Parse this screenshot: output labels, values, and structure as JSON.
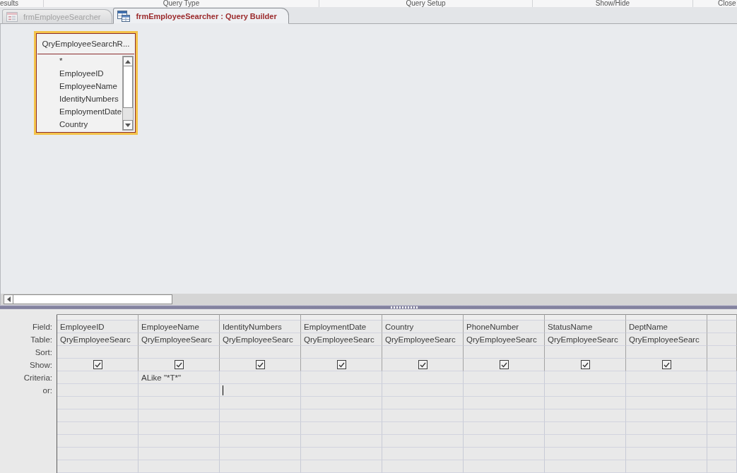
{
  "ribbon_groups": [
    {
      "label": "esults"
    },
    {
      "label": "Query Type"
    },
    {
      "label": "Query Setup"
    },
    {
      "label": "Show/Hide"
    },
    {
      "label": "Close"
    }
  ],
  "document_tabs": [
    {
      "label": "frmEmployeeSearcher",
      "kind": "form",
      "selected": false
    },
    {
      "label": "frmEmployeeSearcher : Query Builder",
      "kind": "query",
      "selected": true
    }
  ],
  "field_list": {
    "title": "QryEmployeeSearchR...",
    "fields": [
      "*",
      "EmployeeID",
      "EmployeeName",
      "IdentityNumbers",
      "EmploymentDate",
      "Country"
    ]
  },
  "design_grid": {
    "rows": [
      {
        "label": "Field:",
        "kind": "field"
      },
      {
        "label": "Table:",
        "kind": "table"
      },
      {
        "label": "Sort:",
        "kind": "sort"
      },
      {
        "label": "Show:",
        "kind": "show"
      },
      {
        "label": "Criteria:",
        "kind": "criteria"
      },
      {
        "label": "or:",
        "kind": "or"
      }
    ],
    "columns": [
      {
        "field": "EmployeeID",
        "table": "QryEmployeeSearc",
        "show": true,
        "editing": false
      },
      {
        "field": "EmployeeName",
        "table": "QryEmployeeSearc",
        "show": true,
        "criteria": "ALike \"*T*\"",
        "editing": false
      },
      {
        "field": "IdentityNumbers",
        "table": "QryEmployeeSearc",
        "show": true,
        "editing": true
      },
      {
        "field": "EmploymentDate",
        "table": "QryEmployeeSearc",
        "show": true,
        "editing": false
      },
      {
        "field": "Country",
        "table": "QryEmployeeSearc",
        "show": true,
        "editing": false
      },
      {
        "field": "PhoneNumber",
        "table": "QryEmployeeSearc",
        "show": true,
        "editing": false
      },
      {
        "field": "StatusName",
        "table": "QryEmployeeSearc",
        "show": true,
        "editing": false
      },
      {
        "field": "DeptName",
        "table": "QryEmployeeSearc",
        "show": true,
        "editing": false
      }
    ]
  }
}
